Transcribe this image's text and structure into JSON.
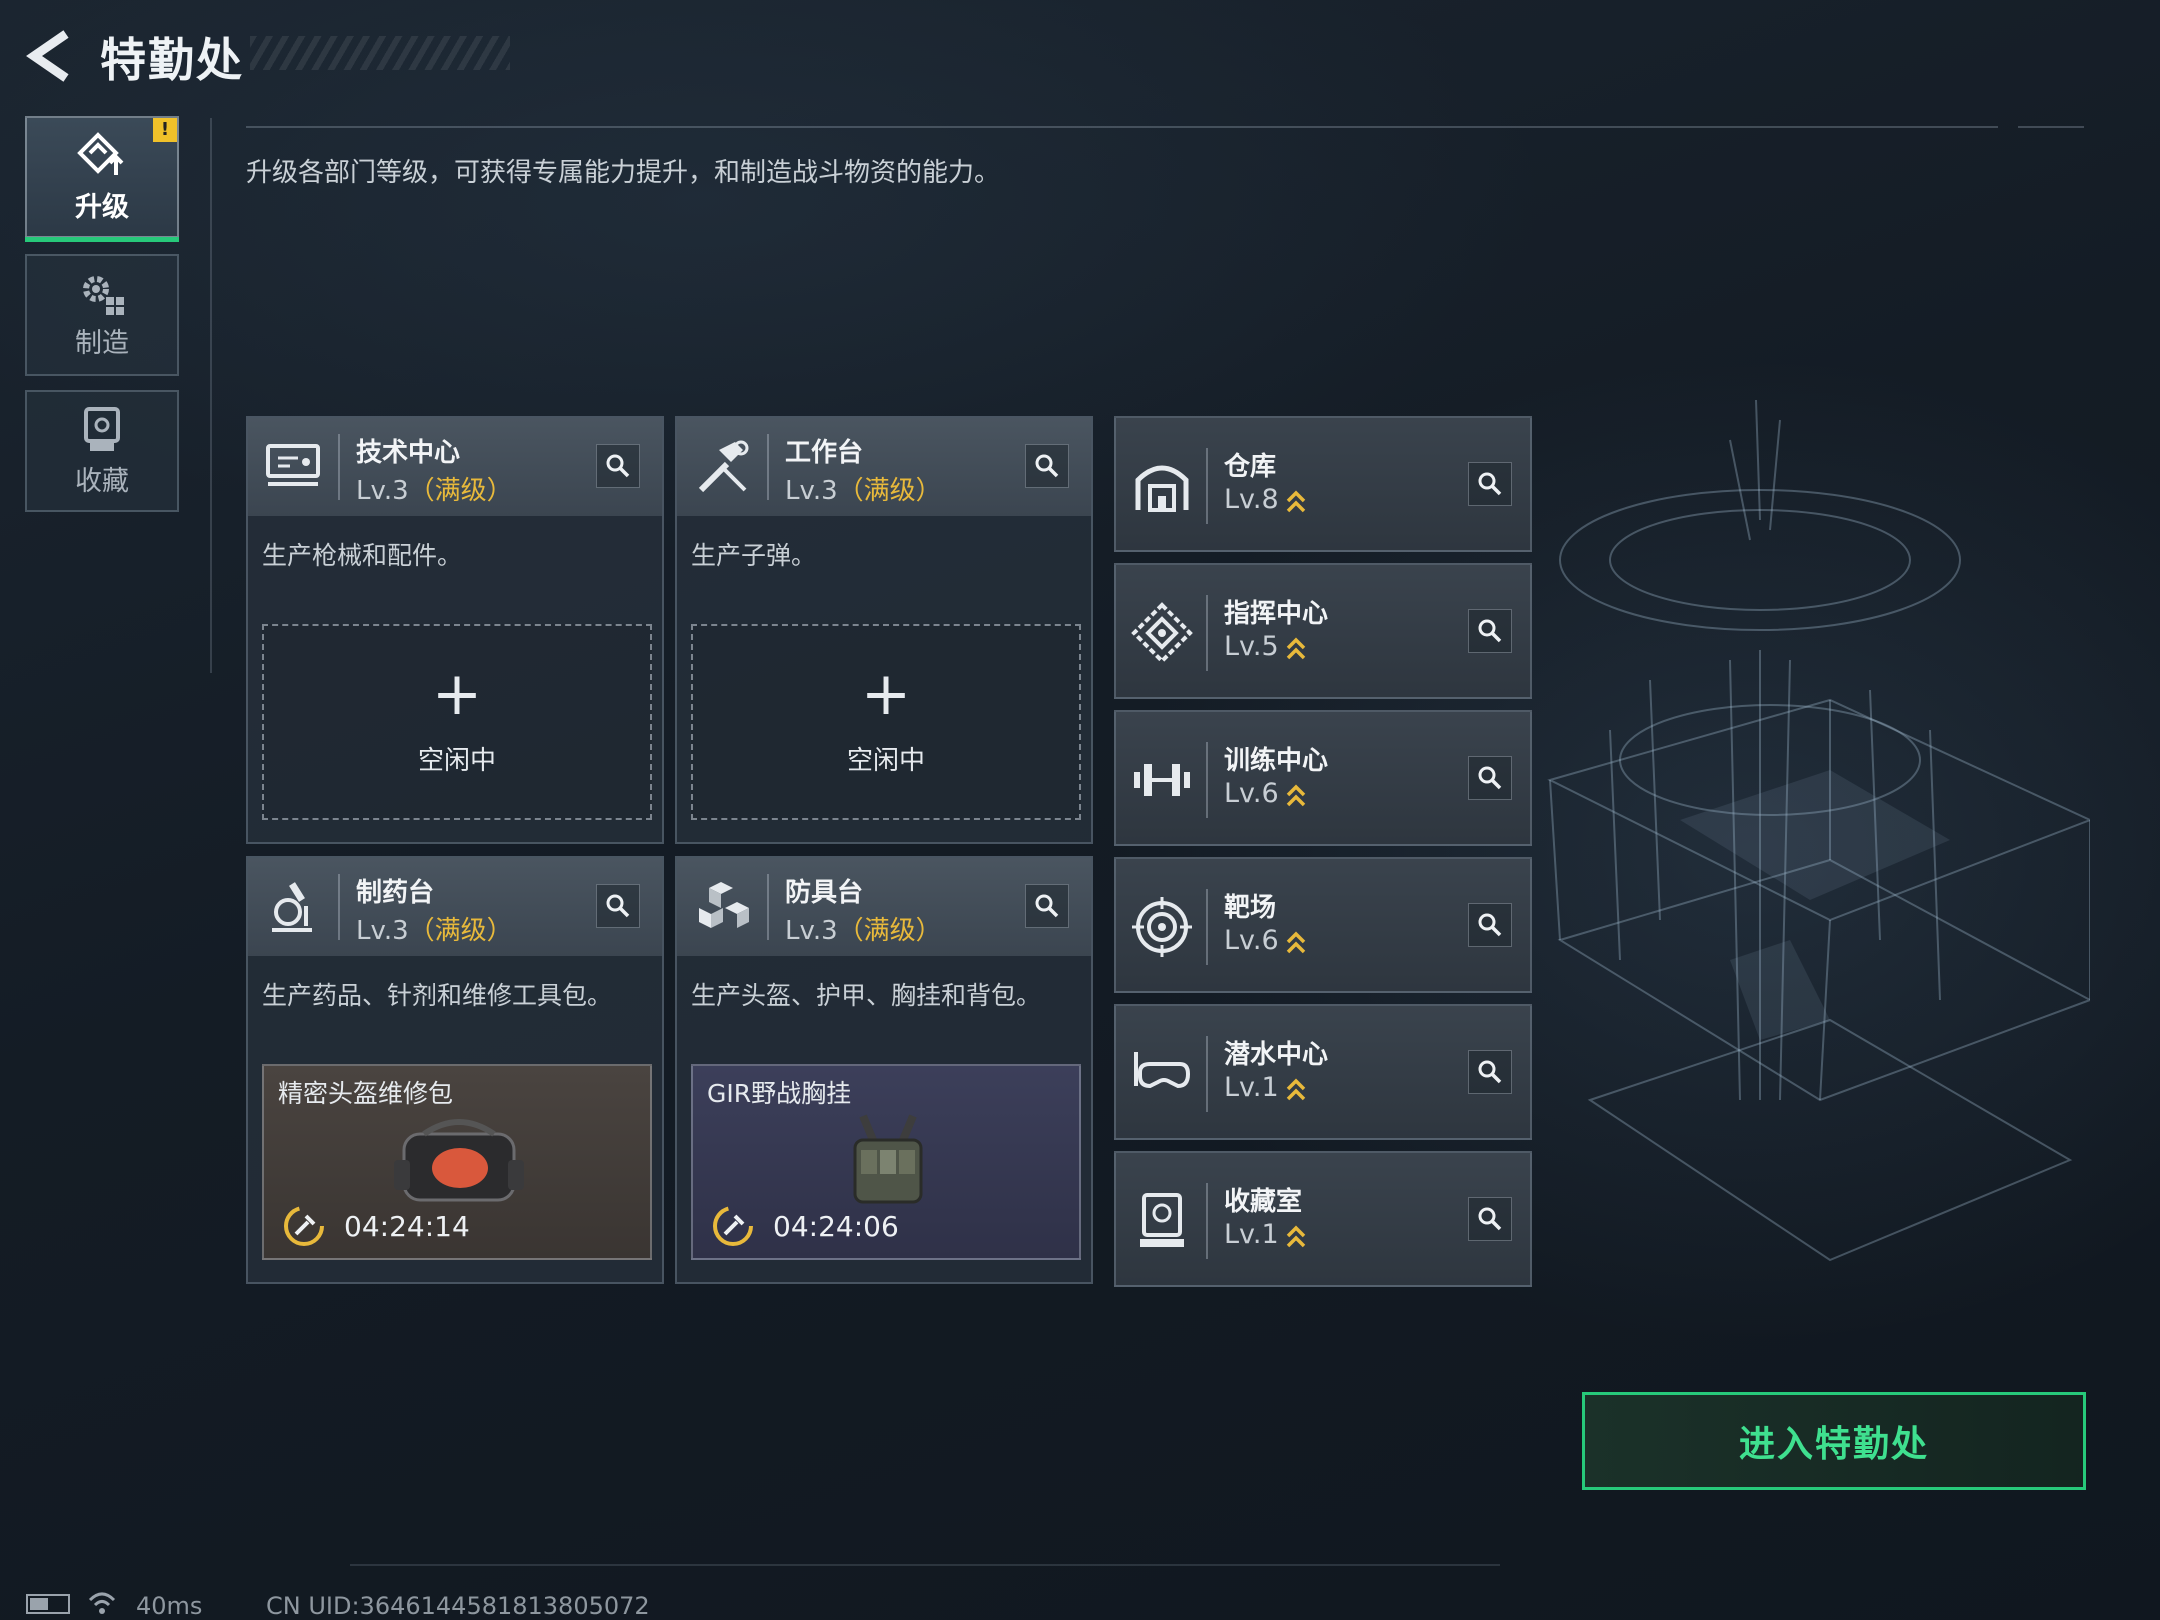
{
  "header": {
    "title": "特勤处",
    "description": "升级各部门等级，可获得专属能力提升，和制造战斗物资的能力。"
  },
  "sidebar": {
    "tabs": [
      {
        "label": "升级",
        "icon": "upgrade-icon",
        "active": true,
        "badge": "!"
      },
      {
        "label": "制造",
        "icon": "gears-icon",
        "active": false
      },
      {
        "label": "收藏",
        "icon": "collection-icon",
        "active": false
      }
    ]
  },
  "workbenches": [
    {
      "name": "技术中心",
      "level": "Lv.3",
      "max_tag": "（满级）",
      "icon": "computer-icon",
      "description": "生产枪械和配件。",
      "slot": {
        "state": "idle",
        "plus": "+",
        "text": "空闲中"
      }
    },
    {
      "name": "工作台",
      "level": "Lv.3",
      "max_tag": "（满级）",
      "icon": "hammer-wrench-icon",
      "description": "生产子弹。",
      "slot": {
        "state": "idle",
        "plus": "+",
        "text": "空闲中"
      }
    },
    {
      "name": "制药台",
      "level": "Lv.3",
      "max_tag": "（满级）",
      "icon": "microscope-icon",
      "description": "生产药品、针剂和维修工具包。",
      "slot": {
        "state": "crafting",
        "item": "精密头盔维修包",
        "timer": "04:24:14"
      }
    },
    {
      "name": "防具台",
      "level": "Lv.3",
      "max_tag": "（满级）",
      "icon": "cubes-icon",
      "description": "生产头盔、护甲、胸挂和背包。",
      "slot": {
        "state": "crafting",
        "item": "GIR野战胸挂",
        "timer": "04:24:06"
      }
    }
  ],
  "facilities": [
    {
      "name": "仓库",
      "level": "Lv.8",
      "icon": "warehouse-icon"
    },
    {
      "name": "指挥中心",
      "level": "Lv.5",
      "icon": "command-icon"
    },
    {
      "name": "训练中心",
      "level": "Lv.6",
      "icon": "dumbbell-icon"
    },
    {
      "name": "靶场",
      "level": "Lv.6",
      "icon": "target-icon"
    },
    {
      "name": "潜水中心",
      "level": "Lv.1",
      "icon": "diving-mask-icon"
    },
    {
      "name": "收藏室",
      "level": "Lv.1",
      "icon": "display-case-icon"
    }
  ],
  "enter_button": "进入特勤处",
  "footer": {
    "ping": "40ms",
    "uid": "CN UID:3646144581813805072"
  },
  "colors": {
    "accent_green": "#27c97a",
    "max_level_gold": "#e8b93b",
    "badge_yellow": "#f0c12a"
  }
}
